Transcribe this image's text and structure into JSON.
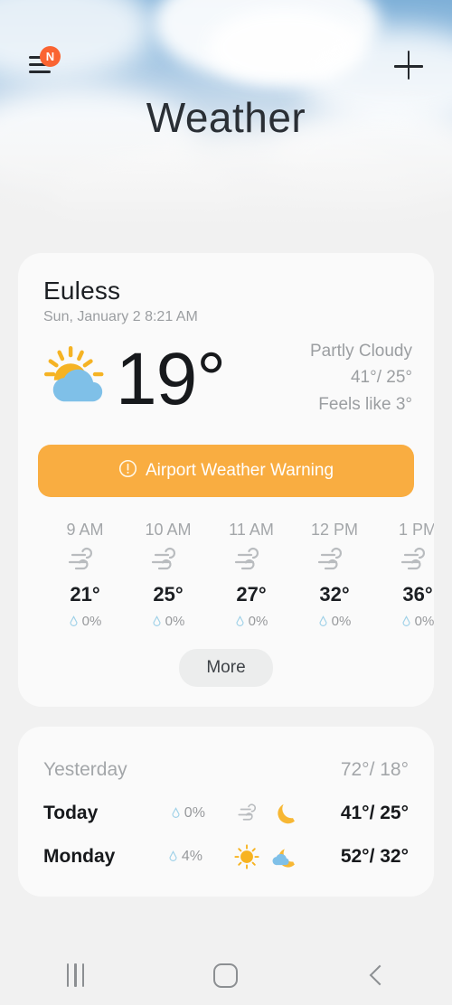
{
  "header": {
    "title": "Weather",
    "menu_icon": "hamburger-menu-icon",
    "menu_badge": "N",
    "add_icon": "plus-icon"
  },
  "current": {
    "city": "Euless",
    "datetime": "Sun, January 2 8:21 AM",
    "temperature": "19°",
    "condition_icon": "partly-cloudy-icon",
    "condition": "Partly Cloudy",
    "high_low": "41°/ 25°",
    "feels_like": "Feels like 3°",
    "warning": {
      "icon": "warning-exclamation-icon",
      "label": "Airport Weather Warning"
    }
  },
  "hourly": {
    "more_label": "More",
    "items": [
      {
        "time": "9 AM",
        "icon": "windy-icon",
        "temp": "21°",
        "precipitation": "0%"
      },
      {
        "time": "10 AM",
        "icon": "windy-icon",
        "temp": "25°",
        "precipitation": "0%"
      },
      {
        "time": "11 AM",
        "icon": "windy-icon",
        "temp": "27°",
        "precipitation": "0%"
      },
      {
        "time": "12 PM",
        "icon": "windy-icon",
        "temp": "32°",
        "precipitation": "0%"
      },
      {
        "time": "1 PM",
        "icon": "windy-icon",
        "temp": "36°",
        "precipitation": "0%"
      }
    ]
  },
  "daily": [
    {
      "day": "Yesterday",
      "precipitation": "",
      "icons": [],
      "temps": "72°/ 18°"
    },
    {
      "day": "Today",
      "precipitation": "0%",
      "icons": [
        "windy-icon",
        "moon-icon"
      ],
      "temps": "41°/ 25°"
    },
    {
      "day": "Monday",
      "precipitation": "4%",
      "icons": [
        "sunny-icon",
        "moon-cloud-icon"
      ],
      "temps": "52°/ 32°"
    }
  ],
  "navbar": {
    "recents": "recents-icon",
    "home": "home-icon",
    "back": "back-icon"
  },
  "colors": {
    "warning_bg": "#f9ad41",
    "badge": "#fa6432",
    "sun": "#f5b324",
    "cloud": "#7fc0e8",
    "droplet": "#9fd1e8"
  }
}
